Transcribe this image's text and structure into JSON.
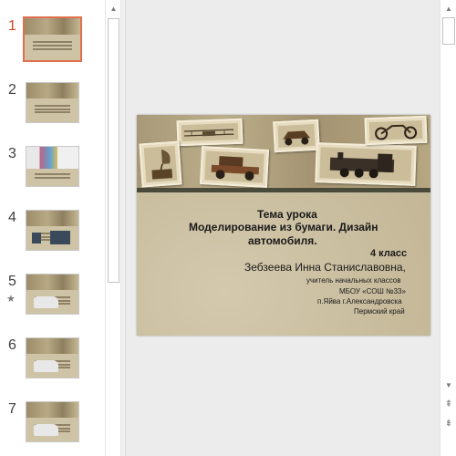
{
  "thumbnails": [
    {
      "number": "1",
      "active": true,
      "starred": false,
      "style": "title"
    },
    {
      "number": "2",
      "active": false,
      "starred": false,
      "style": "text"
    },
    {
      "number": "3",
      "active": false,
      "starred": false,
      "style": "colorful"
    },
    {
      "number": "4",
      "active": false,
      "starred": false,
      "style": "photos"
    },
    {
      "number": "5",
      "active": false,
      "starred": true,
      "style": "car"
    },
    {
      "number": "6",
      "active": false,
      "starred": false,
      "style": "car"
    },
    {
      "number": "7",
      "active": false,
      "starred": false,
      "style": "car"
    }
  ],
  "slide": {
    "topic": "Тема урока",
    "title_line1": "Моделирование из бумаги. Дизайн",
    "title_line2": "автомобиля.",
    "grade": "4 класс",
    "author": "Зебзеева Инна Станиславовна,",
    "position": "учитель начальных классов",
    "school": "МБОУ «СОШ №33»",
    "location": "п.Яйва г.Александровска",
    "region": "Пермский край"
  },
  "scroll": {
    "up_icon": "▲",
    "down_icon": "▼",
    "prev_slide_icon": "⇞",
    "next_slide_icon": "⇟",
    "star_icon": "★"
  },
  "colors": {
    "active_accent": "#d24726",
    "slide_background": "#cdc2a5"
  }
}
